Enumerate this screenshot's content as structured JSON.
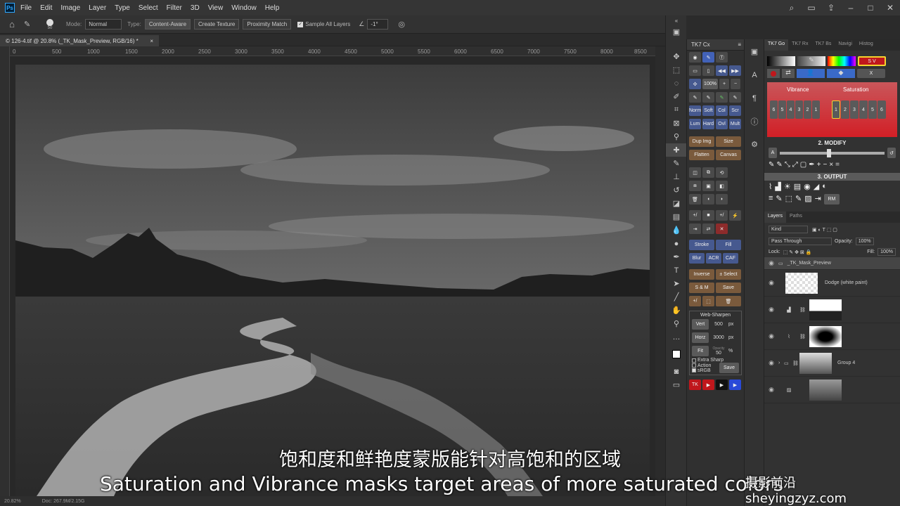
{
  "menubar": {
    "app_icon": "Ps",
    "items": [
      "File",
      "Edit",
      "Image",
      "Layer",
      "Type",
      "Select",
      "Filter",
      "3D",
      "View",
      "Window",
      "Help"
    ],
    "right_icons": [
      "search-icon",
      "workspace-icon",
      "share-icon",
      "minimize-icon",
      "maximize-icon",
      "close-icon"
    ]
  },
  "options": {
    "brush_size": "50",
    "mode_label": "Mode:",
    "mode_value": "Normal",
    "type_label": "Type:",
    "type_buttons": [
      "Content-Aware",
      "Create Texture",
      "Proximity Match"
    ],
    "sample_all": "Sample All Layers",
    "angle": "-1°"
  },
  "document": {
    "tab_title": "© 126-4.tif @ 20.8% (_TK_Mask_Preview, RGB/16) *",
    "ruler_ticks": [
      "0",
      "500",
      "1000",
      "1500",
      "2000",
      "2500",
      "3000",
      "3500",
      "4000",
      "4500",
      "5000",
      "5500",
      "6000",
      "6500",
      "7000",
      "7500",
      "8000",
      "8500"
    ],
    "zoom": "20.82%",
    "doc_size": "Doc: 267.9M/2.15G"
  },
  "tk7cx": {
    "title": "TK7 Cx",
    "rows": [
      [
        "Norm",
        "Soft",
        "Col",
        "Scr"
      ],
      [
        "Lum",
        "Hard",
        "Ovl",
        "Mult"
      ]
    ],
    "dup_img": "Dup Img",
    "size": "Size",
    "flatten": "Flatten",
    "canvas": "Canvas",
    "stroke": "Stroke",
    "fill": "Fill",
    "blur": "Blur",
    "acr": "ACR",
    "caf": "CAF",
    "inverse": "Inverse",
    "plus_select": "± Select",
    "s_and_m": "S & M",
    "save": "Save",
    "web_sharpen": {
      "title": "Web-Sharpen",
      "vert": "Vert",
      "vert_value": "500",
      "horz": "Horz",
      "horz_value": "3000",
      "px": "px",
      "fit": "Fit",
      "opacity_label": "Opacity",
      "opacity_value": "50",
      "pct": "%",
      "extra_sharp": "Extra Sharp",
      "action": "Action",
      "srgb": "sRGB",
      "save": "Save"
    },
    "tk_label": "TK",
    "pct_100": "100%"
  },
  "tk7go": {
    "tabs": [
      "TK7 Go",
      "TK7 Rx",
      "TK7 Bs",
      "Navigi",
      "Histog"
    ],
    "sv_button": "S V",
    "x_button": "X",
    "vibrance": "Vibrance",
    "saturation": "Saturation",
    "vib_nums": [
      "6",
      "5",
      "4",
      "3",
      "2",
      "1"
    ],
    "sat_nums": [
      "1",
      "2",
      "3",
      "4",
      "5",
      "6"
    ],
    "modify": "2. MODIFY",
    "a_label": "A",
    "output": "3. OUTPUT",
    "rm": "RM"
  },
  "layers": {
    "tabs": [
      "Layers",
      "Paths"
    ],
    "kind": "Kind",
    "blend": "Pass Through",
    "opacity_label": "Opacity:",
    "opacity": "100%",
    "lock_label": "Lock:",
    "fill_label": "Fill:",
    "fill": "100%",
    "items": [
      {
        "name": "_TK_Mask_Preview"
      },
      {
        "name": "Dodge (white paint)"
      },
      {
        "name": ""
      },
      {
        "name": ""
      },
      {
        "name": "Group 4"
      },
      {
        "name": ""
      }
    ]
  },
  "subtitles": {
    "cn": "饱和度和鲜艳度蒙版能针对高饱和的区域",
    "en": "Saturation and Vibrance masks target areas of more saturated colors"
  },
  "watermark": "摄影前沿 sheyingzyz.com",
  "colors": {
    "accent_blue": "#46598f",
    "accent_red": "#c0171c",
    "panel": "#323232"
  }
}
